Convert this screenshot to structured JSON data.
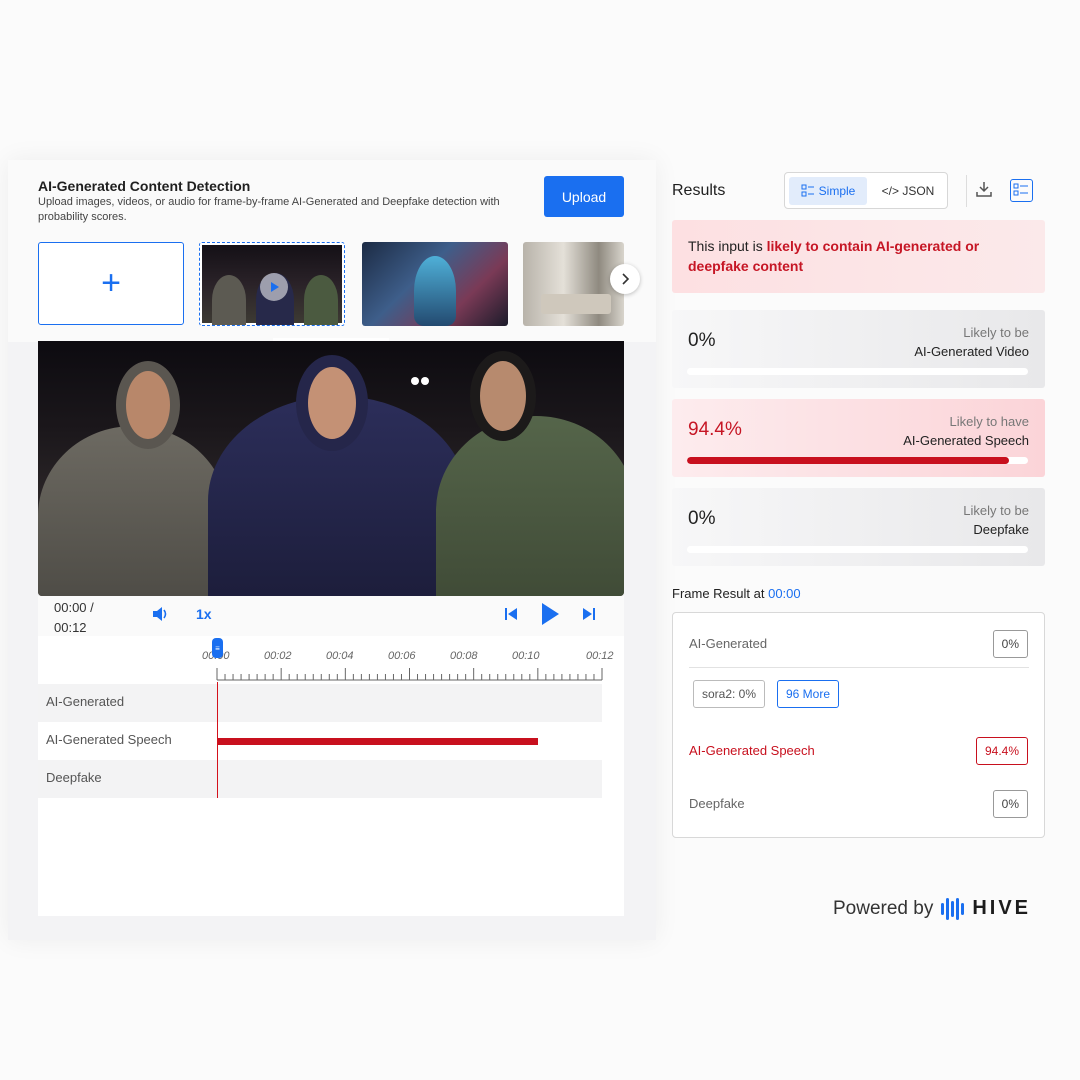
{
  "header": {
    "title": "AI-Generated Content Detection",
    "subtitle": "Upload images, videos, or audio for frame-by-frame AI-Generated and Deepfake detection with probability scores.",
    "upload_label": "Upload",
    "add_icon": "+"
  },
  "player": {
    "current_time": "00:00 /",
    "duration": "00:12",
    "speed": "1x"
  },
  "timeline": {
    "ticks": [
      "00:00",
      "00:02",
      "00:04",
      "00:06",
      "00:08",
      "00:10",
      "00:12"
    ],
    "tracks": [
      "AI-Generated",
      "AI-Generated Speech",
      "Deepfake"
    ],
    "speech_segment": {
      "start": 0,
      "end": 10.0
    }
  },
  "results": {
    "title": "Results",
    "toggle_simple": "Simple",
    "toggle_json": "</> JSON",
    "verdict_prefix": "This input is ",
    "verdict_strong": "likely to contain AI-generated or deepfake content",
    "cards": [
      {
        "pct": "0%",
        "line1": "Likely to be",
        "line2": "AI-Generated Video",
        "fill": 0
      },
      {
        "pct": "94.4%",
        "line1": "Likely to have",
        "line2": "AI-Generated Speech",
        "fill": 0.944
      },
      {
        "pct": "0%",
        "line1": "Likely to be",
        "line2": "Deepfake",
        "fill": 0
      }
    ]
  },
  "frame_result": {
    "label": "Frame Result at ",
    "time": "00:00",
    "rows": {
      "ai_generated": {
        "label": "AI-Generated",
        "value": "0%"
      },
      "speech": {
        "label": "AI-Generated Speech",
        "value": "94.4%"
      },
      "deepfake": {
        "label": "Deepfake",
        "value": "0%"
      }
    },
    "chips": {
      "sora": "sora2: 0%",
      "more": "96 More"
    }
  },
  "footer": {
    "powered_by": "Powered by",
    "brand": "HIVE"
  },
  "colors": {
    "accent": "#1a6ff0",
    "alert": "#c8101e"
  }
}
